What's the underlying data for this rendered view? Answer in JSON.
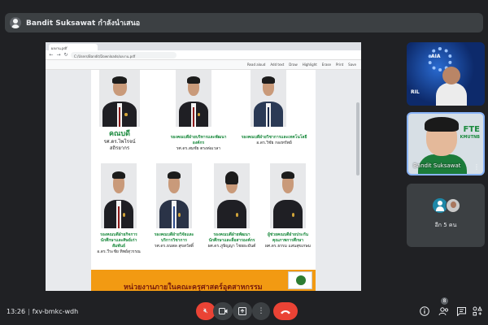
{
  "presenter": {
    "text": "Bandit Suksawat กำลังนำเสนอ"
  },
  "browser": {
    "tab_title": "ผลงาน.pdf",
    "address": "C:/Users/Bandit/Downloads/ผลงาน.pdf",
    "pdf_tools": [
      "Read aloud",
      "Add text",
      "Draw",
      "Highlight",
      "Erase",
      "Print",
      "Save"
    ]
  },
  "slide": {
    "row1": [
      {
        "title": "คณบดี",
        "name": "รศ.ดร.ไพโรจน์ สถิรยากร"
      },
      {
        "title": "รองคณบดีฝ่ายบริหารและพัฒนาองค์กร",
        "name": "รศ.ดร.สมชัย ตรงต่อเวลา"
      },
      {
        "title": "รองคณบดีฝ่ายวิชาการและเทคโนโลยี",
        "name": "อ.ดร.วิชัย กองทรัพย์"
      }
    ],
    "row2": [
      {
        "title": "รองคณบดีฝ่ายกิจการนักศึกษาและศิษย์เก่าสัมพันธ์",
        "name": "อ.ดร.วีระชัย ทิพย์สุวรรณ"
      },
      {
        "title": "รองคณบดีฝ่ายวิจัยและบริการวิชาการ",
        "name": "รศ.ดร.ธนพล สุขสวัสดิ์"
      },
      {
        "title": "รองคณบดีฝ่ายพัฒนานักศึกษาและสื่อสารองค์กร",
        "name": "ผศ.ดร.ภูษิญญา ไชยยะยันต์"
      },
      {
        "title": "ผู้ช่วยคณบดีฝ่ายประกันคุณภาพการศึกษา",
        "name": "ผศ.ดร.ธรรม แสนสุขเกษม"
      }
    ],
    "banner_text": "หน่วยงานภายในคณะครุศาสตร์อุตสาหกรรม"
  },
  "tiles": {
    "tile1": {
      "label": "AIA",
      "caption": "RIL"
    },
    "tile2": {
      "logo": "FTE",
      "logo_sub": "KMUTNB",
      "name": "Bandit Suksawat"
    },
    "tile3": {
      "label": "อีก 5 คน"
    }
  },
  "bottom": {
    "time": "13:26",
    "meeting_code": "fxv-bmkc-wdh",
    "people_count": "8"
  }
}
